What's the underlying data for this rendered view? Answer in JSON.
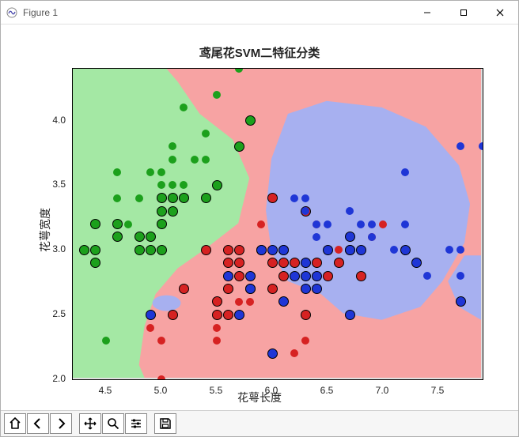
{
  "window": {
    "title": "Figure 1",
    "buttons": {
      "minimize": "Minimize",
      "maximize": "Maximize",
      "close": "Close"
    }
  },
  "toolbar": {
    "home": "Home",
    "back": "Back",
    "forward": "Forward",
    "pan": "Pan",
    "zoom": "Zoom",
    "configure": "Configure subplots",
    "save": "Save"
  },
  "chart_data": {
    "type": "scatter",
    "title": "鸢尾花SVM二特征分类",
    "xlabel": "花萼长度",
    "ylabel": "花萼宽度",
    "xlim": [
      4.2,
      7.9
    ],
    "ylim": [
      2.0,
      4.4
    ],
    "xticks": [
      4.5,
      5.0,
      5.5,
      6.0,
      6.5,
      7.0,
      7.5
    ],
    "yticks": [
      2.0,
      2.5,
      3.0,
      3.5,
      4.0
    ],
    "class_colors": {
      "setosa": "#1ca01c",
      "versicolor": "#d62222",
      "virginica": "#1f36d6"
    },
    "region_colors": {
      "setosa": "#a4e8a4",
      "versicolor": "#f7a3a3",
      "virginica": "#a7b0f0"
    },
    "series": [
      {
        "name": "setosa",
        "color": "#1ca01c",
        "points": [
          [
            4.3,
            3.0
          ],
          [
            4.4,
            2.9
          ],
          [
            4.4,
            3.0
          ],
          [
            4.4,
            3.2
          ],
          [
            4.5,
            2.3
          ],
          [
            4.6,
            3.1
          ],
          [
            4.6,
            3.2
          ],
          [
            4.6,
            3.4
          ],
          [
            4.6,
            3.6
          ],
          [
            4.7,
            3.2
          ],
          [
            4.8,
            3.0
          ],
          [
            4.8,
            3.1
          ],
          [
            4.8,
            3.4
          ],
          [
            4.9,
            3.0
          ],
          [
            4.9,
            3.1
          ],
          [
            4.9,
            3.6
          ],
          [
            5.0,
            3.0
          ],
          [
            5.0,
            3.2
          ],
          [
            5.0,
            3.3
          ],
          [
            5.0,
            3.4
          ],
          [
            5.0,
            3.5
          ],
          [
            5.0,
            3.6
          ],
          [
            5.1,
            3.3
          ],
          [
            5.1,
            3.4
          ],
          [
            5.1,
            3.5
          ],
          [
            5.1,
            3.7
          ],
          [
            5.1,
            3.8
          ],
          [
            5.2,
            3.4
          ],
          [
            5.2,
            3.5
          ],
          [
            5.2,
            4.1
          ],
          [
            5.3,
            3.7
          ],
          [
            5.4,
            3.4
          ],
          [
            5.4,
            3.7
          ],
          [
            5.4,
            3.9
          ],
          [
            5.5,
            3.5
          ],
          [
            5.5,
            4.2
          ],
          [
            5.7,
            3.8
          ],
          [
            5.7,
            4.4
          ],
          [
            5.8,
            4.0
          ]
        ],
        "support_vectors": [
          [
            4.3,
            3.0
          ],
          [
            4.4,
            2.9
          ],
          [
            4.4,
            3.0
          ],
          [
            4.4,
            3.2
          ],
          [
            4.6,
            3.1
          ],
          [
            4.6,
            3.2
          ],
          [
            4.8,
            3.0
          ],
          [
            4.8,
            3.1
          ],
          [
            4.9,
            3.0
          ],
          [
            4.9,
            3.1
          ],
          [
            5.0,
            3.0
          ],
          [
            5.0,
            3.2
          ],
          [
            5.0,
            3.3
          ],
          [
            5.0,
            3.4
          ],
          [
            5.1,
            3.3
          ],
          [
            5.1,
            3.4
          ],
          [
            5.2,
            3.4
          ],
          [
            5.4,
            3.4
          ],
          [
            5.5,
            3.5
          ],
          [
            5.7,
            3.8
          ],
          [
            5.8,
            4.0
          ]
        ]
      },
      {
        "name": "versicolor",
        "color": "#d62222",
        "points": [
          [
            4.9,
            2.4
          ],
          [
            5.0,
            2.0
          ],
          [
            5.0,
            2.3
          ],
          [
            5.1,
            2.5
          ],
          [
            5.2,
            2.7
          ],
          [
            5.4,
            3.0
          ],
          [
            5.5,
            2.3
          ],
          [
            5.5,
            2.4
          ],
          [
            5.5,
            2.5
          ],
          [
            5.5,
            2.6
          ],
          [
            5.6,
            2.5
          ],
          [
            5.6,
            2.7
          ],
          [
            5.6,
            2.9
          ],
          [
            5.6,
            3.0
          ],
          [
            5.7,
            2.6
          ],
          [
            5.7,
            2.8
          ],
          [
            5.7,
            2.9
          ],
          [
            5.7,
            3.0
          ],
          [
            5.8,
            2.6
          ],
          [
            5.8,
            2.7
          ],
          [
            5.9,
            3.0
          ],
          [
            5.9,
            3.2
          ],
          [
            6.0,
            2.2
          ],
          [
            6.0,
            2.7
          ],
          [
            6.0,
            2.9
          ],
          [
            6.0,
            3.4
          ],
          [
            6.1,
            2.8
          ],
          [
            6.1,
            2.9
          ],
          [
            6.1,
            3.0
          ],
          [
            6.2,
            2.2
          ],
          [
            6.2,
            2.9
          ],
          [
            6.3,
            2.3
          ],
          [
            6.3,
            2.5
          ],
          [
            6.3,
            3.3
          ],
          [
            6.4,
            2.9
          ],
          [
            6.4,
            3.2
          ],
          [
            6.5,
            2.8
          ],
          [
            6.6,
            2.9
          ],
          [
            6.6,
            3.0
          ],
          [
            6.7,
            3.0
          ],
          [
            6.7,
            3.1
          ],
          [
            6.8,
            2.8
          ],
          [
            6.9,
            3.1
          ],
          [
            7.0,
            3.2
          ]
        ],
        "support_vectors": [
          [
            5.1,
            2.5
          ],
          [
            5.2,
            2.7
          ],
          [
            5.4,
            3.0
          ],
          [
            5.5,
            2.5
          ],
          [
            5.5,
            2.6
          ],
          [
            5.6,
            2.5
          ],
          [
            5.6,
            2.7
          ],
          [
            5.6,
            2.9
          ],
          [
            5.6,
            3.0
          ],
          [
            5.7,
            2.8
          ],
          [
            5.7,
            2.9
          ],
          [
            5.7,
            3.0
          ],
          [
            5.8,
            2.7
          ],
          [
            5.9,
            3.0
          ],
          [
            6.0,
            2.7
          ],
          [
            6.0,
            2.9
          ],
          [
            6.0,
            3.4
          ],
          [
            6.1,
            2.8
          ],
          [
            6.1,
            2.9
          ],
          [
            6.1,
            3.0
          ],
          [
            6.2,
            2.9
          ],
          [
            6.3,
            2.5
          ],
          [
            6.3,
            3.3
          ],
          [
            6.4,
            2.9
          ],
          [
            6.5,
            2.8
          ],
          [
            6.6,
            2.9
          ],
          [
            6.7,
            3.0
          ],
          [
            6.8,
            2.8
          ]
        ]
      },
      {
        "name": "virginica",
        "color": "#1f36d6",
        "points": [
          [
            4.9,
            2.5
          ],
          [
            5.6,
            2.8
          ],
          [
            5.7,
            2.5
          ],
          [
            5.8,
            2.7
          ],
          [
            5.8,
            2.8
          ],
          [
            5.9,
            3.0
          ],
          [
            6.0,
            2.2
          ],
          [
            6.0,
            3.0
          ],
          [
            6.1,
            2.6
          ],
          [
            6.1,
            3.0
          ],
          [
            6.2,
            2.8
          ],
          [
            6.2,
            3.4
          ],
          [
            6.3,
            2.7
          ],
          [
            6.3,
            2.8
          ],
          [
            6.3,
            2.9
          ],
          [
            6.3,
            3.3
          ],
          [
            6.3,
            3.4
          ],
          [
            6.4,
            2.7
          ],
          [
            6.4,
            2.8
          ],
          [
            6.4,
            3.1
          ],
          [
            6.4,
            3.2
          ],
          [
            6.5,
            3.0
          ],
          [
            6.5,
            3.2
          ],
          [
            6.7,
            2.5
          ],
          [
            6.7,
            3.0
          ],
          [
            6.7,
            3.1
          ],
          [
            6.7,
            3.3
          ],
          [
            6.8,
            3.0
          ],
          [
            6.8,
            3.2
          ],
          [
            6.9,
            3.1
          ],
          [
            6.9,
            3.2
          ],
          [
            7.1,
            3.0
          ],
          [
            7.2,
            3.0
          ],
          [
            7.2,
            3.2
          ],
          [
            7.2,
            3.6
          ],
          [
            7.3,
            2.9
          ],
          [
            7.4,
            2.8
          ],
          [
            7.6,
            3.0
          ],
          [
            7.7,
            2.6
          ],
          [
            7.7,
            2.8
          ],
          [
            7.7,
            3.0
          ],
          [
            7.7,
            3.8
          ],
          [
            7.9,
            3.8
          ]
        ],
        "support_vectors": [
          [
            4.9,
            2.5
          ],
          [
            5.6,
            2.8
          ],
          [
            5.7,
            2.5
          ],
          [
            5.8,
            2.7
          ],
          [
            5.8,
            2.8
          ],
          [
            5.9,
            3.0
          ],
          [
            6.0,
            2.2
          ],
          [
            6.0,
            3.0
          ],
          [
            6.1,
            2.6
          ],
          [
            6.1,
            3.0
          ],
          [
            6.2,
            2.8
          ],
          [
            6.3,
            2.7
          ],
          [
            6.3,
            2.8
          ],
          [
            6.3,
            2.9
          ],
          [
            6.4,
            2.7
          ],
          [
            6.4,
            2.8
          ],
          [
            6.5,
            3.0
          ],
          [
            6.7,
            2.5
          ],
          [
            6.7,
            3.0
          ],
          [
            6.7,
            3.1
          ],
          [
            6.8,
            3.0
          ],
          [
            7.2,
            3.0
          ],
          [
            7.3,
            2.9
          ],
          [
            7.7,
            2.6
          ]
        ]
      }
    ]
  }
}
